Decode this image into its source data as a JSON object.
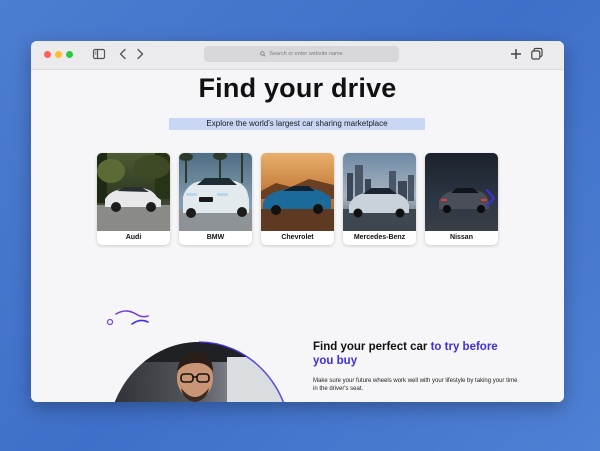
{
  "browser": {
    "url_placeholder": "Search or enter website name"
  },
  "hero": {
    "title": "Find your drive",
    "subtitle": "Explore the world's largest car sharing marketplace"
  },
  "cars": [
    {
      "label": "Audi"
    },
    {
      "label": "BMW"
    },
    {
      "label": "Chevrolet"
    },
    {
      "label": "Mercedes-Benz"
    },
    {
      "label": "Nissan"
    }
  ],
  "section": {
    "title_main": "Find your perfect car ",
    "title_highlight": "to try before you buy",
    "body": "Make sure your future wheels work well with your lifestyle by taking your time in the driver's seat."
  },
  "colors": {
    "accent": "#3d2fe0",
    "highlight_bg": "#c9d7f4",
    "page_bg": "#4a7acd"
  }
}
